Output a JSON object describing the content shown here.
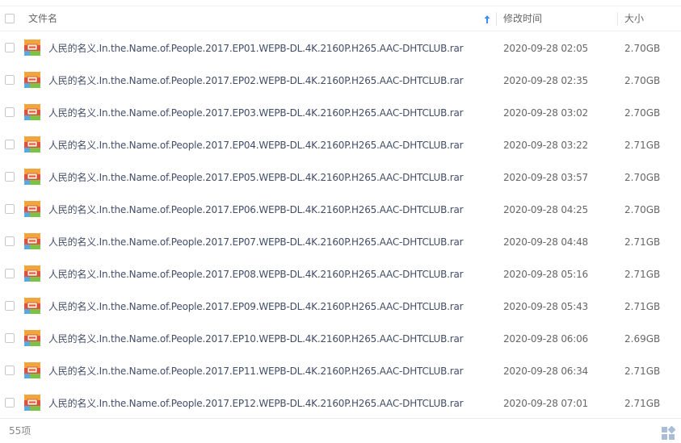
{
  "header": {
    "name_label": "文件名",
    "time_label": "修改时间",
    "size_label": "大小",
    "sort_icon": "sort-up-arrow-icon",
    "accent_color": "#3b8cff"
  },
  "files": [
    {
      "name": "人民的名义.In.the.Name.of.People.2017.EP01.WEPB-DL.4K.2160P.H265.AAC-DHTCLUB.rar",
      "time": "2020-09-28 02:05",
      "size": "2.70GB"
    },
    {
      "name": "人民的名义.In.the.Name.of.People.2017.EP02.WEPB-DL.4K.2160P.H265.AAC-DHTCLUB.rar",
      "time": "2020-09-28 02:35",
      "size": "2.70GB"
    },
    {
      "name": "人民的名义.In.the.Name.of.People.2017.EP03.WEPB-DL.4K.2160P.H265.AAC-DHTCLUB.rar",
      "time": "2020-09-28 03:02",
      "size": "2.70GB"
    },
    {
      "name": "人民的名义.In.the.Name.of.People.2017.EP04.WEPB-DL.4K.2160P.H265.AAC-DHTCLUB.rar",
      "time": "2020-09-28 03:22",
      "size": "2.71GB"
    },
    {
      "name": "人民的名义.In.the.Name.of.People.2017.EP05.WEPB-DL.4K.2160P.H265.AAC-DHTCLUB.rar",
      "time": "2020-09-28 03:57",
      "size": "2.70GB"
    },
    {
      "name": "人民的名义.In.the.Name.of.People.2017.EP06.WEPB-DL.4K.2160P.H265.AAC-DHTCLUB.rar",
      "time": "2020-09-28 04:25",
      "size": "2.70GB"
    },
    {
      "name": "人民的名义.In.the.Name.of.People.2017.EP07.WEPB-DL.4K.2160P.H265.AAC-DHTCLUB.rar",
      "time": "2020-09-28 04:48",
      "size": "2.71GB"
    },
    {
      "name": "人民的名义.In.the.Name.of.People.2017.EP08.WEPB-DL.4K.2160P.H265.AAC-DHTCLUB.rar",
      "time": "2020-09-28 05:16",
      "size": "2.71GB"
    },
    {
      "name": "人民的名义.In.the.Name.of.People.2017.EP09.WEPB-DL.4K.2160P.H265.AAC-DHTCLUB.rar",
      "time": "2020-09-28 05:43",
      "size": "2.71GB"
    },
    {
      "name": "人民的名义.In.the.Name.of.People.2017.EP10.WEPB-DL.4K.2160P.H265.AAC-DHTCLUB.rar",
      "time": "2020-09-28 06:06",
      "size": "2.69GB"
    },
    {
      "name": "人民的名义.In.the.Name.of.People.2017.EP11.WEPB-DL.4K.2160P.H265.AAC-DHTCLUB.rar",
      "time": "2020-09-28 06:34",
      "size": "2.71GB"
    },
    {
      "name": "人民的名义.In.the.Name.of.People.2017.EP12.WEPB-DL.4K.2160P.H265.AAC-DHTCLUB.rar",
      "time": "2020-09-28 07:01",
      "size": "2.71GB"
    }
  ],
  "file_icon": "rar-archive-icon",
  "footer": {
    "count_label": "55项",
    "view_icon": "grid-view-icon",
    "view_icon_color": "#a9bdd6"
  }
}
